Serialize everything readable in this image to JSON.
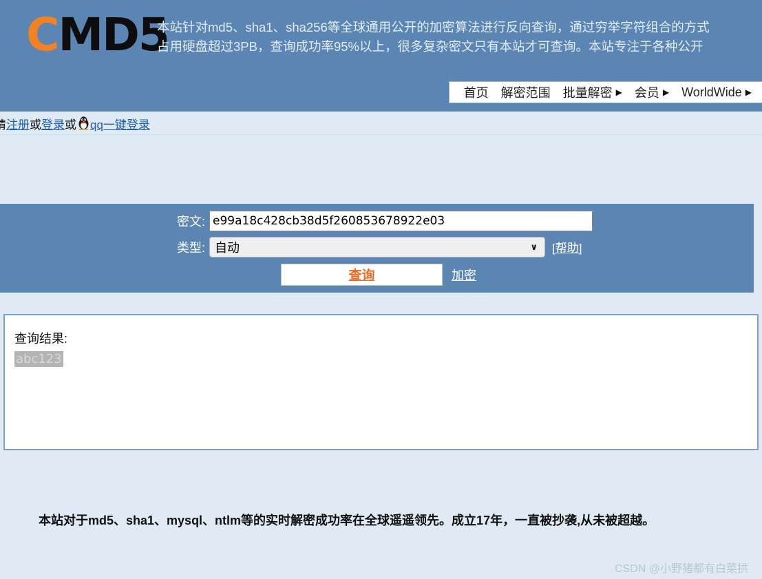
{
  "site": {
    "logo_c": "C",
    "logo_rest": "MD5",
    "description_line1": "本站针对md5、sha1、sha256等全球通用公开的加密算法进行反向查询，通过穷举字符组合的方式",
    "description_line2": "占用硬盘超过3PB，查询成功率95%以上，很多复杂密文只有本站才可查询。本站专注于各种公开"
  },
  "nav": {
    "items": [
      {
        "label": "首页",
        "has_caret": false
      },
      {
        "label": "解密范围",
        "has_caret": false
      },
      {
        "label": "批量解密",
        "has_caret": true
      },
      {
        "label": "会员",
        "has_caret": true
      },
      {
        "label": "WorldWide",
        "has_caret": true
      }
    ],
    "caret_glyph": "▶"
  },
  "login": {
    "prefix": "请",
    "register_label": "注册",
    "or1": "或",
    "login_label": "登录",
    "or2": "或",
    "qq_login_label": "qq一键登录"
  },
  "form": {
    "ciphertext_label": "密文:",
    "ciphertext_value": "e99a18c428cb38d5f260853678922e03",
    "ciphertext_placeholder": "",
    "type_label": "类型:",
    "type_selected": "自动",
    "type_options": [
      "自动"
    ],
    "type_caret_glyph": "∨",
    "help_label": "[帮助]",
    "submit_label": "查询",
    "encrypt_label": "加密"
  },
  "result": {
    "title": "查询结果:",
    "value": "abc123"
  },
  "footer": {
    "note": "本站对于md5、sha1、mysql、ntlm等的实时解密成功率在全球遥遥领先。成立17年，一直被抄袭,从未被超越。",
    "watermark": "CSDN @小野猪都有白菜拱"
  },
  "colors": {
    "header_blue": "#5b85b2",
    "page_bg": "#dfeaf5",
    "logo_orange": "#f58220",
    "submit_orange": "#f4671c",
    "link_blue": "#1c5fb0",
    "result_border": "#7ba2c8"
  }
}
